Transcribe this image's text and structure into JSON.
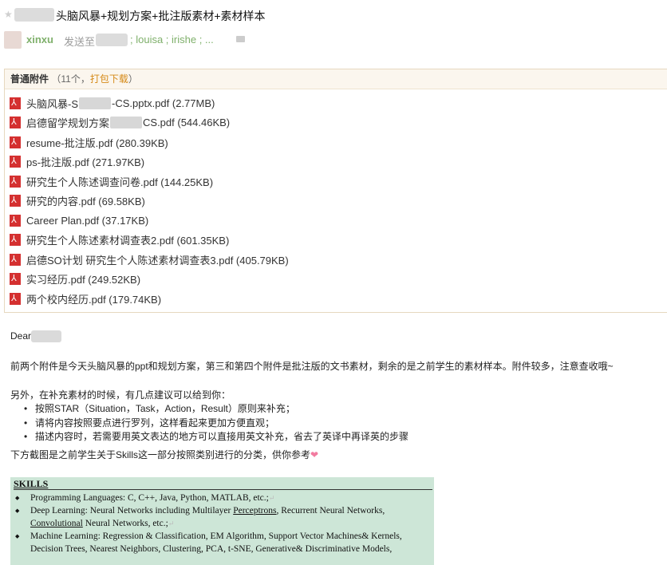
{
  "email": {
    "subject": "头脑风暴+规划方案+批注版素材+素材样本",
    "sender_name": "xinxu",
    "sent_to_label": "发送至",
    "recipients": "; louisa ; irishe ; ..."
  },
  "attachments": {
    "title": "普通附件",
    "count_prefix": "（11个，",
    "download_label": "打包下载",
    "count_suffix": "）",
    "items": [
      {
        "a": "头脑风暴-S",
        "b": "-CS.pptx.pdf (2.77MB)"
      },
      {
        "a": "启德留学规划方案",
        "b": "CS.pdf (544.46KB)"
      },
      {
        "a": "resume-批注版.pdf (280.39KB)"
      },
      {
        "a": "ps-批注版.pdf (271.97KB)"
      },
      {
        "a": "研究生个人陈述调查问卷.pdf (144.25KB)"
      },
      {
        "a": "研究的内容.pdf (69.58KB)"
      },
      {
        "a": "Career Plan.pdf (37.17KB)"
      },
      {
        "a": "研究生个人陈述素材调查表2.pdf (601.35KB)"
      },
      {
        "a": "启德SO计划 研究生个人陈述素材调查表3.pdf (405.79KB)"
      },
      {
        "a": "实习经历.pdf (249.52KB)"
      },
      {
        "a": "两个校内经历.pdf (179.74KB)"
      }
    ]
  },
  "body": {
    "greeting": "Dear",
    "para1": "前两个附件是今天头脑风暴的ppt和规划方案，第三和第四个附件是批注版的文书素材，剩余的是之前学生的素材样本。附件较多，注意查收哦~",
    "para2": "另外，在补充素材的时候，有几点建议可以给到你：",
    "bullets": [
      "按照STAR（Situation，Task，Action，Result）原则来补充；",
      "请将内容按照要点进行罗列，这样看起来更加方便直观；",
      "描述内容时，若需要用英文表达的地方可以直接用英文补充，省去了英译中再译英的步骤"
    ],
    "para3": "下方截图是之前学生关于Skills这一部分按照类别进行的分类，供你参考",
    "heart": "❤"
  },
  "skills": {
    "title": "SKILLS",
    "l1": "Programming Languages: C, C++, Java, Python, MATLAB, etc.;",
    "l2a": "Deep Learning: Neural Networks including Multilayer ",
    "l2b": "Perceptrons",
    "l2c": ", Recurrent Neural Networks,",
    "l2d": "Convolutional",
    "l2e": " Neural Networks, etc.;",
    "l3a": "Machine Learning: Regression & Classification, EM Algorithm, Support Vector Machines& Kernels,",
    "l3b": "Decision Trees, Nearest Neighbors, Clustering, PCA, t-SNE, Generative& Discriminative Models,"
  }
}
